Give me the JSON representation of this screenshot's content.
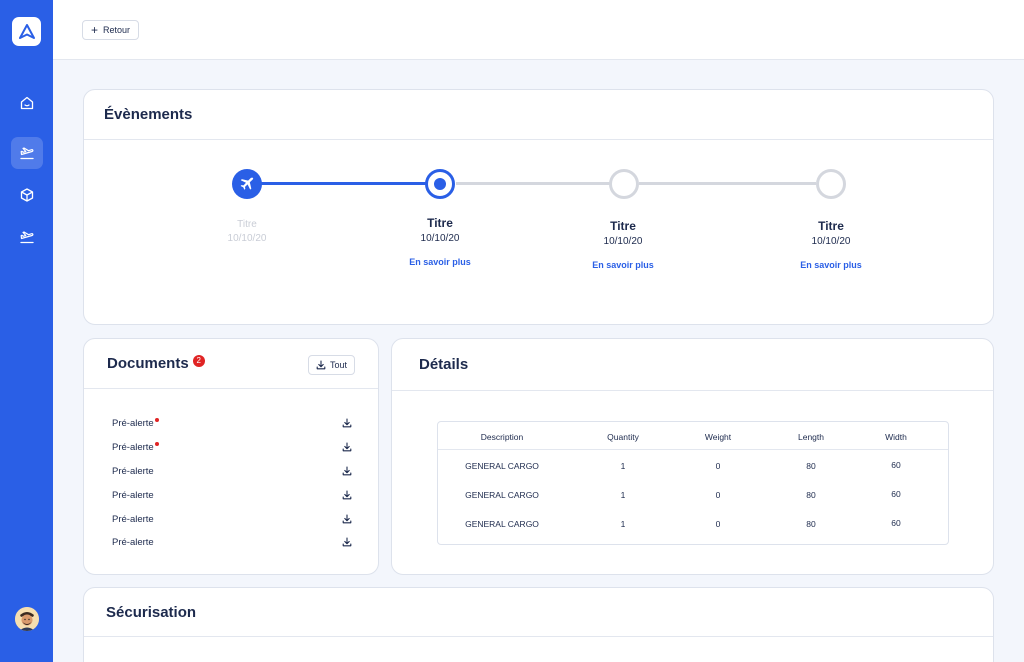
{
  "nav": {
    "back_label": "Retour"
  },
  "sidebar": {
    "items": [
      {
        "icon": "home-icon"
      },
      {
        "icon": "flight-departure-icon",
        "active": true
      },
      {
        "icon": "box-icon"
      },
      {
        "icon": "flight-departure-icon"
      }
    ]
  },
  "events": {
    "title": "Évènements",
    "steps": [
      {
        "title": "Titre",
        "date": "10/10/20",
        "link": ""
      },
      {
        "title": "Titre",
        "date": "10/10/20",
        "link": "En savoir plus"
      },
      {
        "title": "Titre",
        "date": "10/10/20",
        "link": "En savoir plus"
      },
      {
        "title": "Titre",
        "date": "10/10/20",
        "link": "En savoir plus"
      }
    ]
  },
  "documents": {
    "title": "Documents",
    "badge": "2",
    "all_label": "Tout",
    "items": [
      {
        "label": "Pré-alerte",
        "unread": true
      },
      {
        "label": "Pré-alerte",
        "unread": true
      },
      {
        "label": "Pré-alerte",
        "unread": false
      },
      {
        "label": "Pré-alerte",
        "unread": false
      },
      {
        "label": "Pré-alerte",
        "unread": false
      },
      {
        "label": "Pré-alerte",
        "unread": false
      }
    ]
  },
  "details": {
    "title": "Détails",
    "columns": [
      "Description",
      "Quantity",
      "Weight",
      "Length",
      "Width"
    ],
    "rows": [
      [
        "GENERAL CARGO",
        "1",
        "0",
        "80",
        "60"
      ],
      [
        "GENERAL CARGO",
        "1",
        "0",
        "80",
        "60"
      ],
      [
        "GENERAL CARGO",
        "1",
        "0",
        "80",
        "60"
      ]
    ]
  },
  "securisation": {
    "title": "Sécurisation"
  },
  "colors": {
    "primary": "#2a5fe6",
    "sidebar": "#2a5fe6",
    "alert": "#e02424",
    "text": "#1d2a4d"
  }
}
